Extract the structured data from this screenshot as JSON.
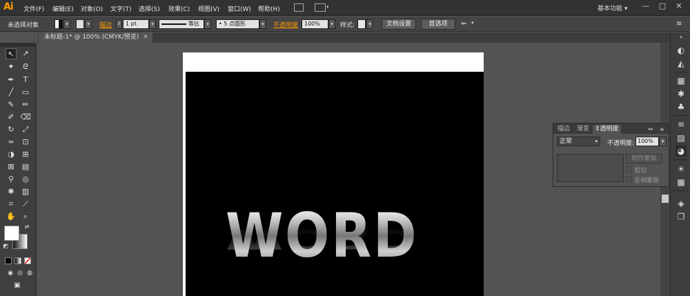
{
  "app": {
    "logo": "Ai"
  },
  "menu": [
    "文件(F)",
    "编辑(E)",
    "对象(O)",
    "文字(T)",
    "选择(S)",
    "效果(C)",
    "视图(V)",
    "窗口(W)",
    "帮助(H)"
  ],
  "window": {
    "workspace": "基本功能",
    "workspace_arrow": "▾",
    "minimize": "—",
    "maximize": "□",
    "close": "✕"
  },
  "controlbar": {
    "selection_status": "未选择对象",
    "stroke_label": "描边",
    "stroke_weight": "1 pt",
    "stroke_profile": "等比",
    "brush": "5 点圆形",
    "opacity_label": "不透明度",
    "opacity_value": "100%",
    "style_label": "样式:",
    "doc_setup_button": "文档设置",
    "preferences_button": "首选项"
  },
  "document_tab": {
    "title": "未标题-1* @ 100% (CMYK/预览)",
    "close": "✕"
  },
  "canvas": {
    "artwork_text": "WORD"
  },
  "transparency_panel": {
    "tabs": [
      "描边",
      "渐变",
      "透明度"
    ],
    "active_tab": "透明度",
    "blend_mode": "正常",
    "opacity_label": "不透明度:",
    "opacity_value": "100%",
    "make_mask_button": "制作蒙版",
    "clip_label": "剪切",
    "invert_mask_label": "反相蒙版"
  },
  "colors": {
    "accent": "#ff9a00",
    "menubar_bg": "#323232",
    "workspace_bg": "#535353",
    "artboard": "#ffffff",
    "background_rect": "#000000"
  }
}
